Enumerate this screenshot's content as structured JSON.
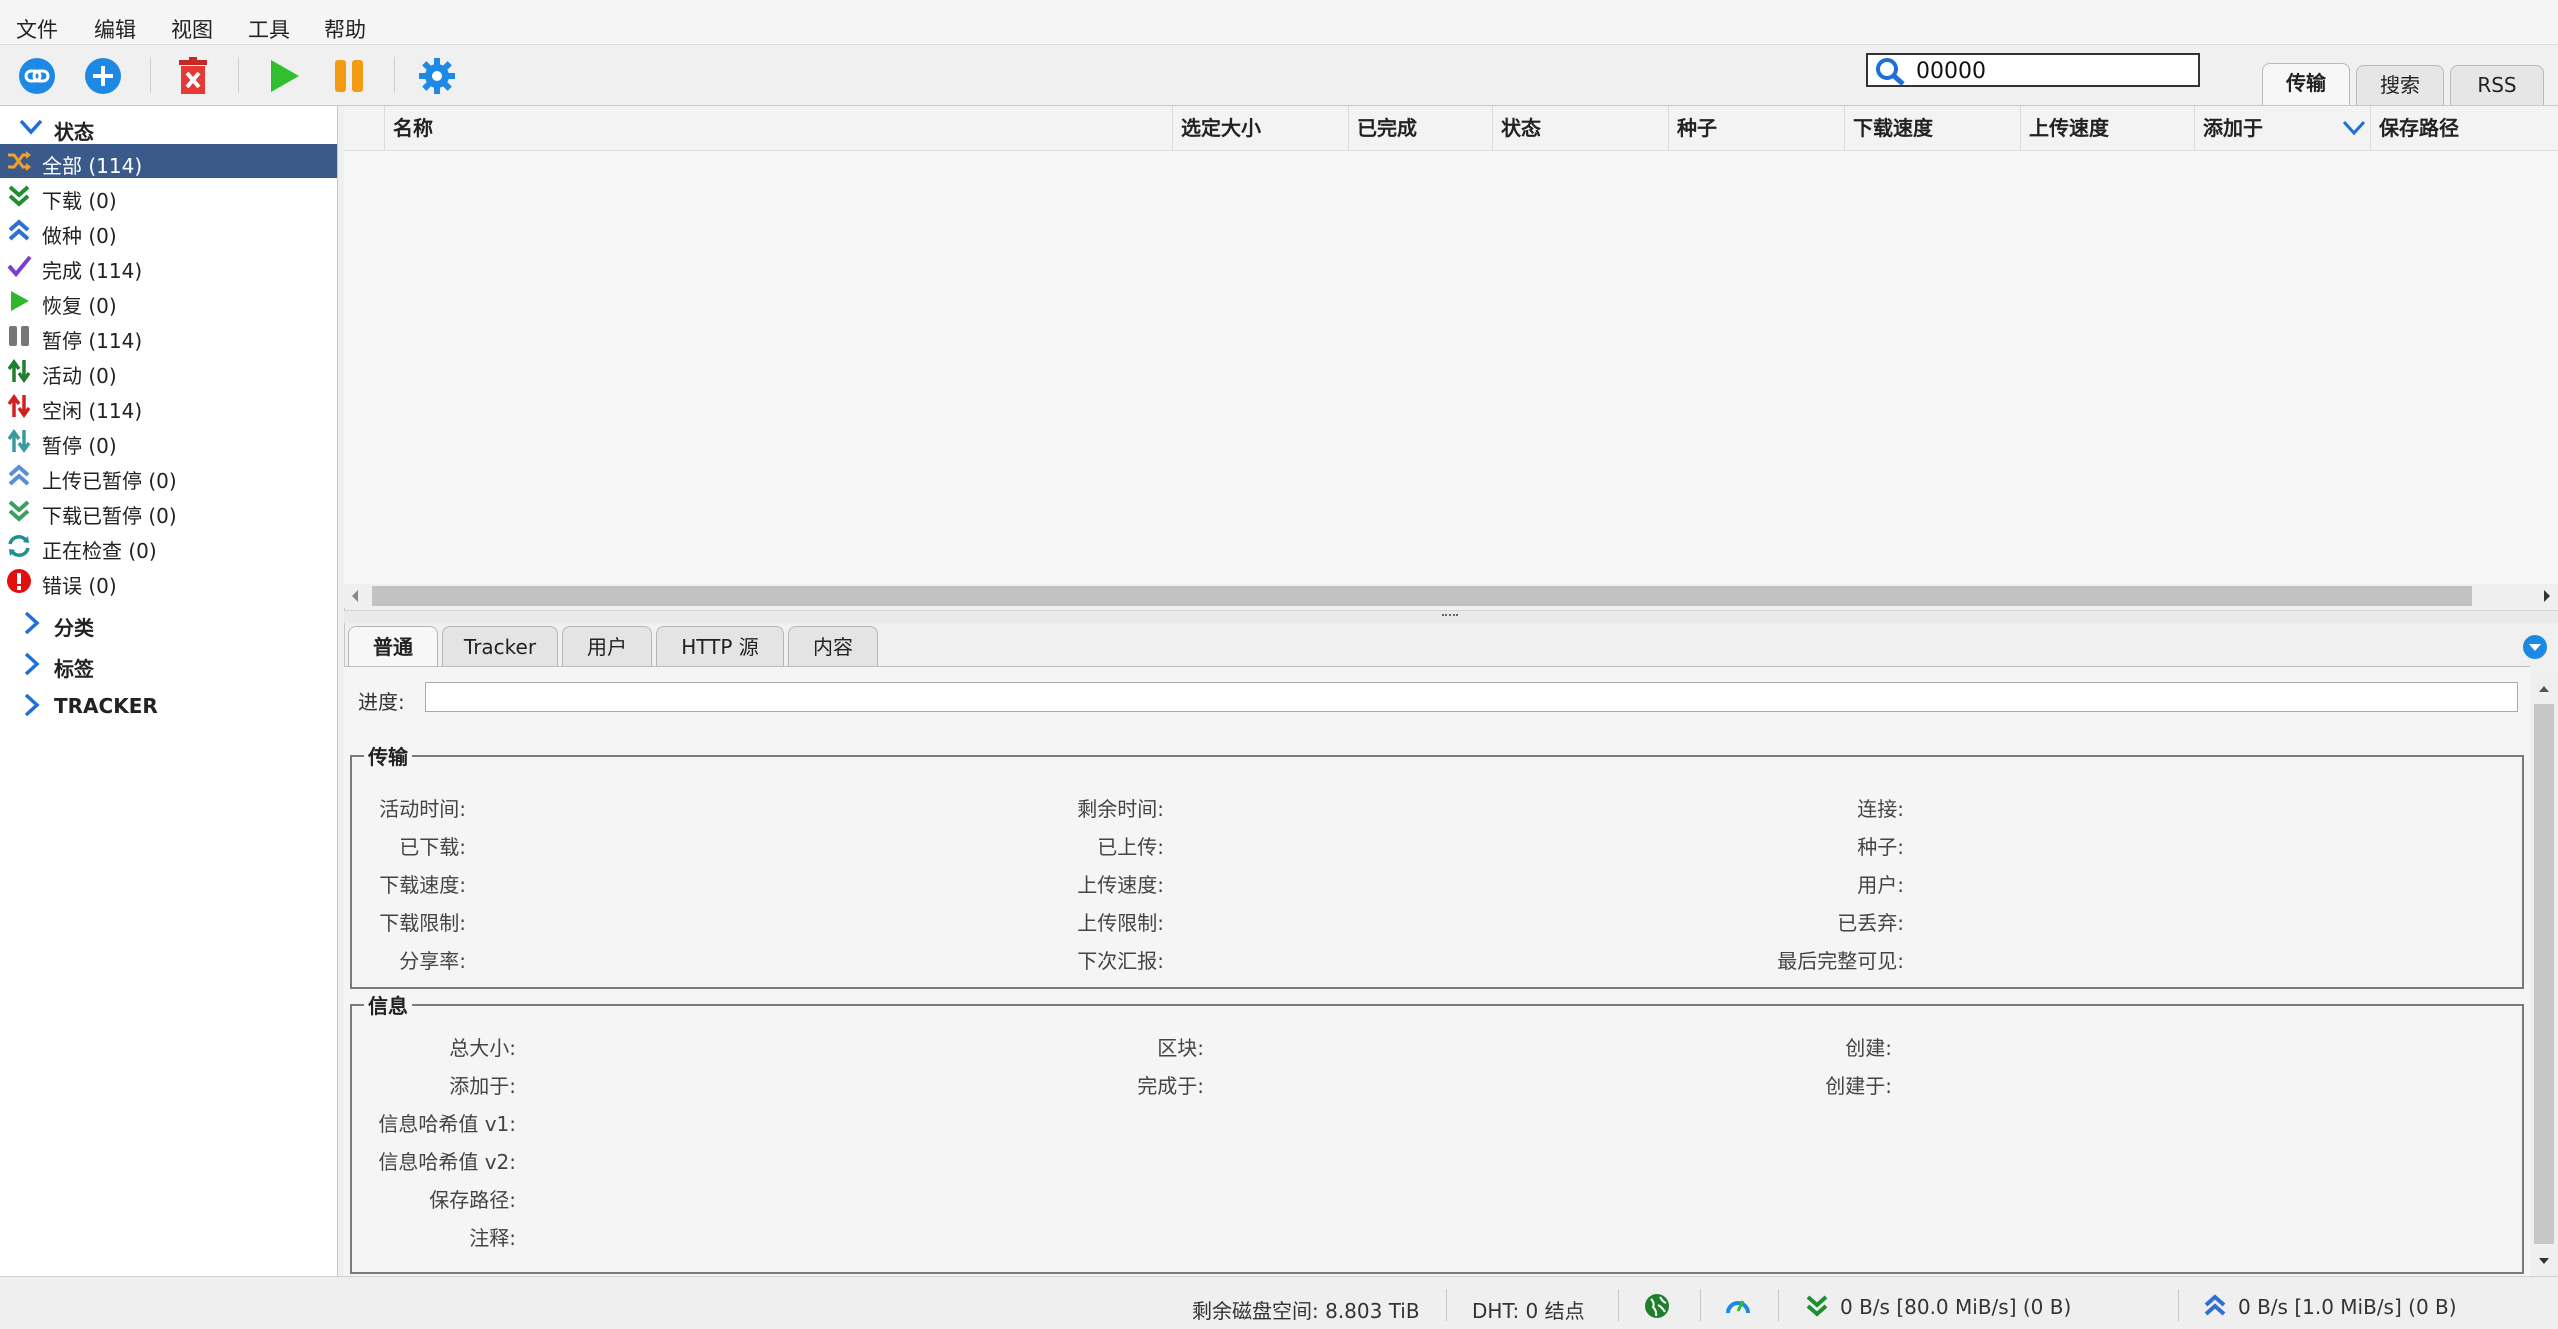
{
  "menu": [
    "文件",
    "编辑",
    "视图",
    "工具",
    "帮助"
  ],
  "toolbar": {
    "icons": [
      "link-icon",
      "add-icon",
      "delete-icon",
      "play-icon",
      "pause-icon",
      "gear-icon"
    ]
  },
  "search": {
    "value": "00000"
  },
  "right_tabs": [
    "传输",
    "搜索",
    "RSS"
  ],
  "sidebar": {
    "status_title": "状态",
    "items": [
      {
        "label": "全部 (114)",
        "icon": "shuffle-icon",
        "color": "#f0a030"
      },
      {
        "label": "下载 (0)",
        "icon": "double-chevron-down-icon",
        "color": "#1f8f2f"
      },
      {
        "label": "做种 (0)",
        "icon": "double-chevron-up-icon",
        "color": "#2f6fd0"
      },
      {
        "label": "完成 (114)",
        "icon": "checkmark-icon",
        "color": "#7a3fd0"
      },
      {
        "label": "恢复 (0)",
        "icon": "play-icon",
        "color": "#2fb82f"
      },
      {
        "label": "暂停 (114)",
        "icon": "pause-icon",
        "color": "#777777"
      },
      {
        "label": "活动 (0)",
        "icon": "up-down-arrows-icon",
        "color": "#1f7f2f"
      },
      {
        "label": "空闲 (114)",
        "icon": "up-down-arrows-icon",
        "color": "#d02020"
      },
      {
        "label": "暂停 (0)",
        "icon": "up-down-arrows-icon",
        "color": "#3a9aa0"
      },
      {
        "label": "上传已暂停 (0)",
        "icon": "double-chevron-up-icon",
        "color": "#5a8fd8"
      },
      {
        "label": "下载已暂停 (0)",
        "icon": "double-chevron-down-icon",
        "color": "#3aa060"
      },
      {
        "label": "正在检查 (0)",
        "icon": "refresh-icon",
        "color": "#1f8f8f"
      },
      {
        "label": "错误 (0)",
        "icon": "error-icon",
        "color": "#e01010"
      }
    ],
    "sections": [
      "分类",
      "标签",
      "TRACKER"
    ]
  },
  "table": {
    "columns": [
      "名称",
      "选定大小",
      "已完成",
      "状态",
      "种子",
      "下载速度",
      "上传速度",
      "添加于",
      "保存路径"
    ]
  },
  "detail_tabs": [
    "普通",
    "Tracker",
    "用户",
    "HTTP 源",
    "内容"
  ],
  "detail": {
    "progress_label": "进度:",
    "transfer_title": "传输",
    "transfer": {
      "col1": [
        "活动时间:",
        "已下载:",
        "下载速度:",
        "下载限制:",
        "分享率:"
      ],
      "col2": [
        "剩余时间:",
        "已上传:",
        "上传速度:",
        "上传限制:",
        "下次汇报:"
      ],
      "col3": [
        "连接:",
        "种子:",
        "用户:",
        "已丢弃:",
        "最后完整可见:"
      ]
    },
    "info_title": "信息",
    "info": {
      "col1": [
        "总大小:",
        "添加于:",
        "信息哈希值 v1:",
        "信息哈希值 v2:",
        "保存路径:",
        "注释:"
      ],
      "col2": [
        "区块:",
        "完成于:"
      ],
      "col3": [
        "创建:",
        "创建于:"
      ]
    }
  },
  "status": {
    "disk": "剩余磁盘空间: 8.803 TiB",
    "dht": "DHT: 0 结点",
    "download": "0 B/s [80.0 MiB/s] (0 B)",
    "upload": "0 B/s [1.0 MiB/s] (0 B)"
  },
  "colors": {
    "selection": "#3a5a8c",
    "accent_blue": "#1e88e5"
  }
}
